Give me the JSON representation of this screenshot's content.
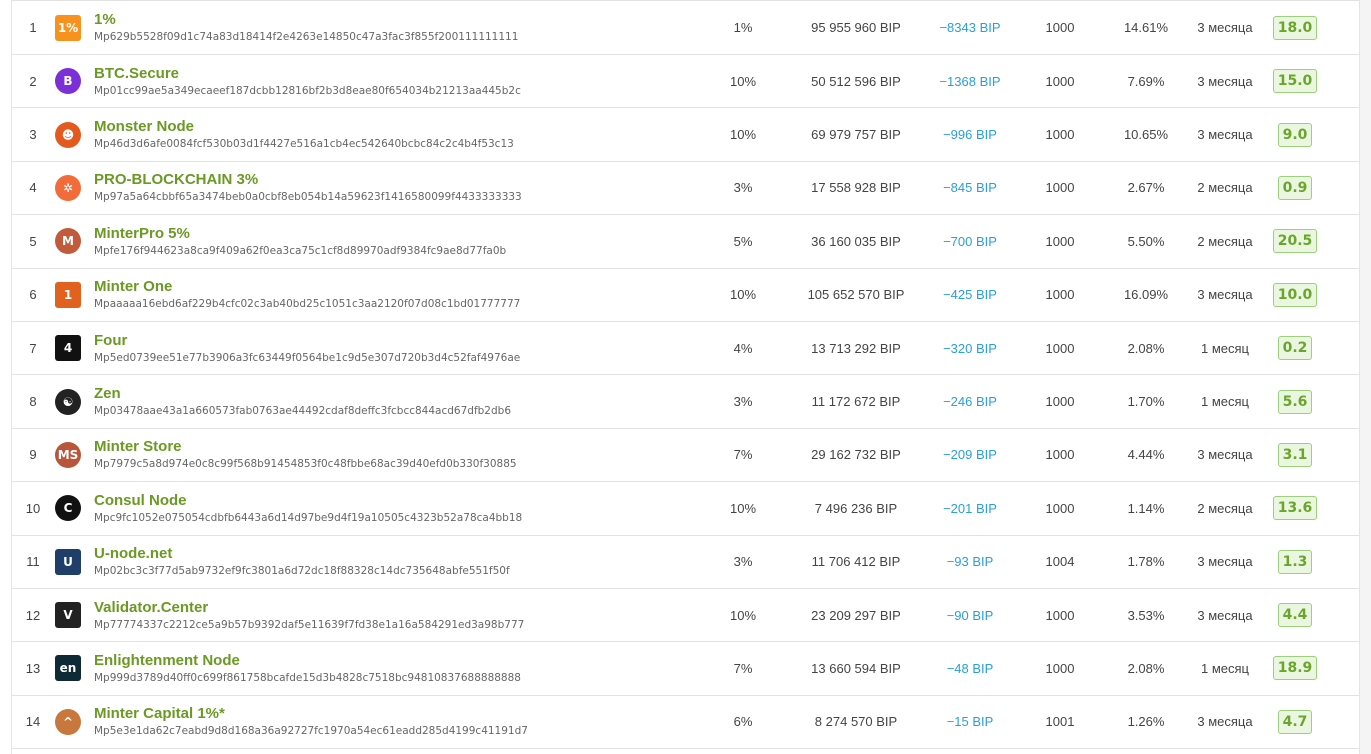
{
  "validators": [
    {
      "rank": "1",
      "name": "1%",
      "address": "Mp629b5528f09d1c74a83d18414f2e4263e14850c47a3fac3f855f200111111111",
      "commission": "1%",
      "stake": "95 955 960 BIP",
      "delta": "−8343 BIP",
      "slots": "1000",
      "share": "14.61%",
      "age": "3 месяца",
      "score": "18.0",
      "logo": {
        "icon": "percent-logo-icon",
        "text": "1%",
        "color": "#f7921e"
      }
    },
    {
      "rank": "2",
      "name": "BTC.Secure",
      "address": "Mp01cc99ae5a349ecaeef187dcbb12816bf2b3d8eae80f654034b21213aa445b2c",
      "commission": "10%",
      "stake": "50 512 596 BIP",
      "delta": "−1368 BIP",
      "slots": "1000",
      "share": "7.69%",
      "age": "3 месяца",
      "score": "15.0",
      "logo": {
        "icon": "btc-secure-logo-icon",
        "text": "B",
        "color": "#7b2fd6"
      }
    },
    {
      "rank": "3",
      "name": "Monster Node",
      "address": "Mp46d3d6afe0084fcf530b03d1f4427e516a1cb4ec542640bcbc84c2c4b4f53c13",
      "commission": "10%",
      "stake": "69 979 757 BIP",
      "delta": "−996 BIP",
      "slots": "1000",
      "share": "10.65%",
      "age": "3 месяца",
      "score": "9.0",
      "logo": {
        "icon": "monster-logo-icon",
        "text": "☻",
        "color": "#e45a1e"
      }
    },
    {
      "rank": "4",
      "name": "PRO-BLOCKCHAIN 3%",
      "address": "Mp97a5a64cbbf65a3474beb0a0cbf8eb054b14a59623f1416580099f4433333333",
      "commission": "3%",
      "stake": "17 558 928 BIP",
      "delta": "−845 BIP",
      "slots": "1000",
      "share": "2.67%",
      "age": "2 месяца",
      "score": "0.9",
      "logo": {
        "icon": "pro-blockchain-logo-icon",
        "text": "✲",
        "color": "#f26b3a"
      }
    },
    {
      "rank": "5",
      "name": "MinterPro 5%",
      "address": "Mpfe176f944623a8ca9f409a62f0ea3ca75c1cf8d89970adf9384fc9ae8d77fa0b",
      "commission": "5%",
      "stake": "36 160 035 BIP",
      "delta": "−700 BIP",
      "slots": "1000",
      "share": "5.50%",
      "age": "2 месяца",
      "score": "20.5",
      "logo": {
        "icon": "minterpro-logo-icon",
        "text": "M",
        "color": "#c25a3c"
      }
    },
    {
      "rank": "6",
      "name": "Minter One",
      "address": "Mpaaaaa16ebd6af229b4cfc02c3ab40bd25c1051c3aa2120f07d08c1bd01777777",
      "commission": "10%",
      "stake": "105 652 570 BIP",
      "delta": "−425 BIP",
      "slots": "1000",
      "share": "16.09%",
      "age": "3 месяца",
      "score": "10.0",
      "logo": {
        "icon": "minter-one-logo-icon",
        "text": "1",
        "color": "#e0621e"
      }
    },
    {
      "rank": "7",
      "name": "Four",
      "address": "Mp5ed0739ee51e77b3906a3fc63449f0564be1c9d5e307d720b3d4c52faf4976ae",
      "commission": "4%",
      "stake": "13 713 292 BIP",
      "delta": "−320 BIP",
      "slots": "1000",
      "share": "2.08%",
      "age": "1 месяц",
      "score": "0.2",
      "logo": {
        "icon": "four-logo-icon",
        "text": "4",
        "color": "#111111"
      }
    },
    {
      "rank": "8",
      "name": "Zen",
      "address": "Mp03478aae43a1a660573fab0763ae44492cdaf8deffc3fcbcc844acd67dfb2db6",
      "commission": "3%",
      "stake": "11 172 672 BIP",
      "delta": "−246 BIP",
      "slots": "1000",
      "share": "1.70%",
      "age": "1 месяц",
      "score": "5.6",
      "logo": {
        "icon": "zen-logo-icon",
        "text": "☯",
        "color": "#222222"
      }
    },
    {
      "rank": "9",
      "name": "Minter Store",
      "address": "Mp7979c5a8d974e0c8c99f568b91454853f0c48fbbe68ac39d40efd0b330f30885",
      "commission": "7%",
      "stake": "29 162 732 BIP",
      "delta": "−209 BIP",
      "slots": "1000",
      "share": "4.44%",
      "age": "3 месяца",
      "score": "3.1",
      "logo": {
        "icon": "minter-store-logo-icon",
        "text": "MS",
        "color": "#b8553a"
      }
    },
    {
      "rank": "10",
      "name": "Consul Node",
      "address": "Mpc9fc1052e075054cdbfb6443a6d14d97be9d4f19a10505c4323b52a78ca4bb18",
      "commission": "10%",
      "stake": "7 496 236 BIP",
      "delta": "−201 BIP",
      "slots": "1000",
      "share": "1.14%",
      "age": "2 месяца",
      "score": "13.6",
      "logo": {
        "icon": "consul-logo-icon",
        "text": "C",
        "color": "#111111"
      }
    },
    {
      "rank": "11",
      "name": "U-node.net",
      "address": "Mp02bc3c3f77d5ab9732ef9fc3801a6d72dc18f88328c14dc735648abfe551f50f",
      "commission": "3%",
      "stake": "11 706 412 BIP",
      "delta": "−93 BIP",
      "slots": "1004",
      "share": "1.78%",
      "age": "3 месяца",
      "score": "1.3",
      "logo": {
        "icon": "u-node-logo-icon",
        "text": "U",
        "color": "#1f3f6a"
      }
    },
    {
      "rank": "12",
      "name": "Validator.Center",
      "address": "Mp77774337c2212ce5a9b57b9392daf5e11639f7fd38e1a16a584291ed3a98b777",
      "commission": "10%",
      "stake": "23 209 297 BIP",
      "delta": "−90 BIP",
      "slots": "1000",
      "share": "3.53%",
      "age": "3 месяца",
      "score": "4.4",
      "logo": {
        "icon": "validator-center-logo-icon",
        "text": "V",
        "color": "#222222"
      }
    },
    {
      "rank": "13",
      "name": "Enlightenment Node",
      "address": "Mp999d3789d40ff0c699f861758bcafde15d3b4828c7518bc94810837688888888",
      "commission": "7%",
      "stake": "13 660 594 BIP",
      "delta": "−48 BIP",
      "slots": "1000",
      "share": "2.08%",
      "age": "1 месяц",
      "score": "18.9",
      "logo": {
        "icon": "enlightenment-logo-icon",
        "text": "en",
        "color": "#0f2a36"
      }
    },
    {
      "rank": "14",
      "name": "Minter Capital 1%*",
      "address": "Mp5e3e1da62c7eabd9d8d168a36a92727fc1970a54ec61eadd285d4199c41191d7",
      "commission": "6%",
      "stake": "8 274 570 BIP",
      "delta": "−15 BIP",
      "slots": "1001",
      "share": "1.26%",
      "age": "3 месяца",
      "score": "4.7",
      "logo": {
        "icon": "minter-capital-logo-icon",
        "text": "^",
        "color": "#c8783c"
      }
    }
  ]
}
